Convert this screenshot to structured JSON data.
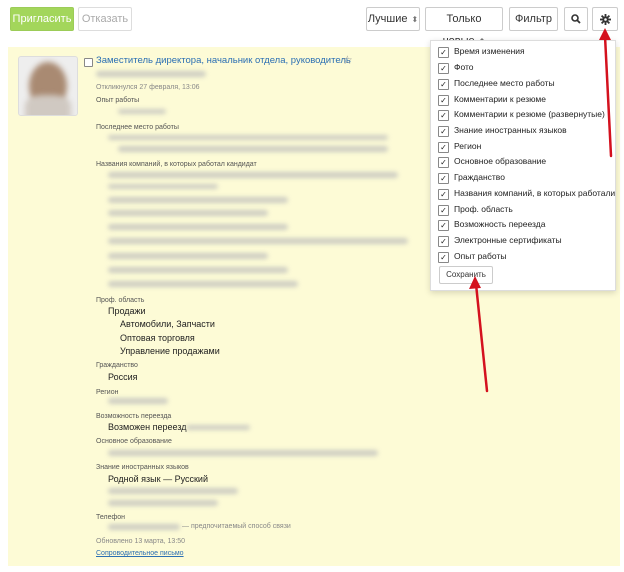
{
  "toolbar": {
    "invite": "Пригласить",
    "reject": "Отказать",
    "sort": "Лучшие",
    "only_new": "Только новые",
    "filter": "Фильтр"
  },
  "resume": {
    "title": "Заместитель директора, начальник отдела, руководитель",
    "responded": "Откликнулся 27 февраля, 13:06",
    "experience_label": "Опыт работы",
    "last_job_label": "Последнее место работы",
    "companies_label": "Названия компаний, в которых работал кандидат",
    "prof_area_label": "Проф. область",
    "prof_area": "Продажи",
    "specializations": [
      "Автомобили, Запчасти",
      "Оптовая торговля",
      "Управление продажами"
    ],
    "citizenship_label": "Гражданство",
    "citizenship": "Россия",
    "region_label": "Регион",
    "relocation_label": "Возможность переезда",
    "relocation": "Возможен переезд",
    "education_label": "Основное образование",
    "languages_label": "Знание иностранных языков",
    "native_language": "Родной язык — Русский",
    "phone_label": "Телефон",
    "phone_note": "— предпочитаемый способ связи",
    "updated": "Обновлено 13 марта, 13:50",
    "cover_letter": "Сопроводительное письмо"
  },
  "settings": {
    "options": [
      {
        "label": "Время изменения",
        "checked": true
      },
      {
        "label": "Фото",
        "checked": true
      },
      {
        "label": "Последнее место работы",
        "checked": true
      },
      {
        "label": "Комментарии к резюме",
        "checked": true
      },
      {
        "label": "Комментарии к резюме (развернутые)",
        "checked": true
      },
      {
        "label": "Знание иностранных языков",
        "checked": true
      },
      {
        "label": "Регион",
        "checked": true
      },
      {
        "label": "Основное образование",
        "checked": true
      },
      {
        "label": "Гражданство",
        "checked": true
      },
      {
        "label": "Названия компаний, в которых работали",
        "checked": true
      },
      {
        "label": "Проф. область",
        "checked": true
      },
      {
        "label": "Возможность переезда",
        "checked": true
      },
      {
        "label": "Электронные сертификаты",
        "checked": true
      },
      {
        "label": "Опыт работы",
        "checked": true
      }
    ],
    "save": "Сохранить"
  },
  "colors": {
    "accent_green": "#a3d65b",
    "link": "#2b6fb3",
    "card_bg": "#fdfbd6",
    "arrow": "#d4111e"
  }
}
